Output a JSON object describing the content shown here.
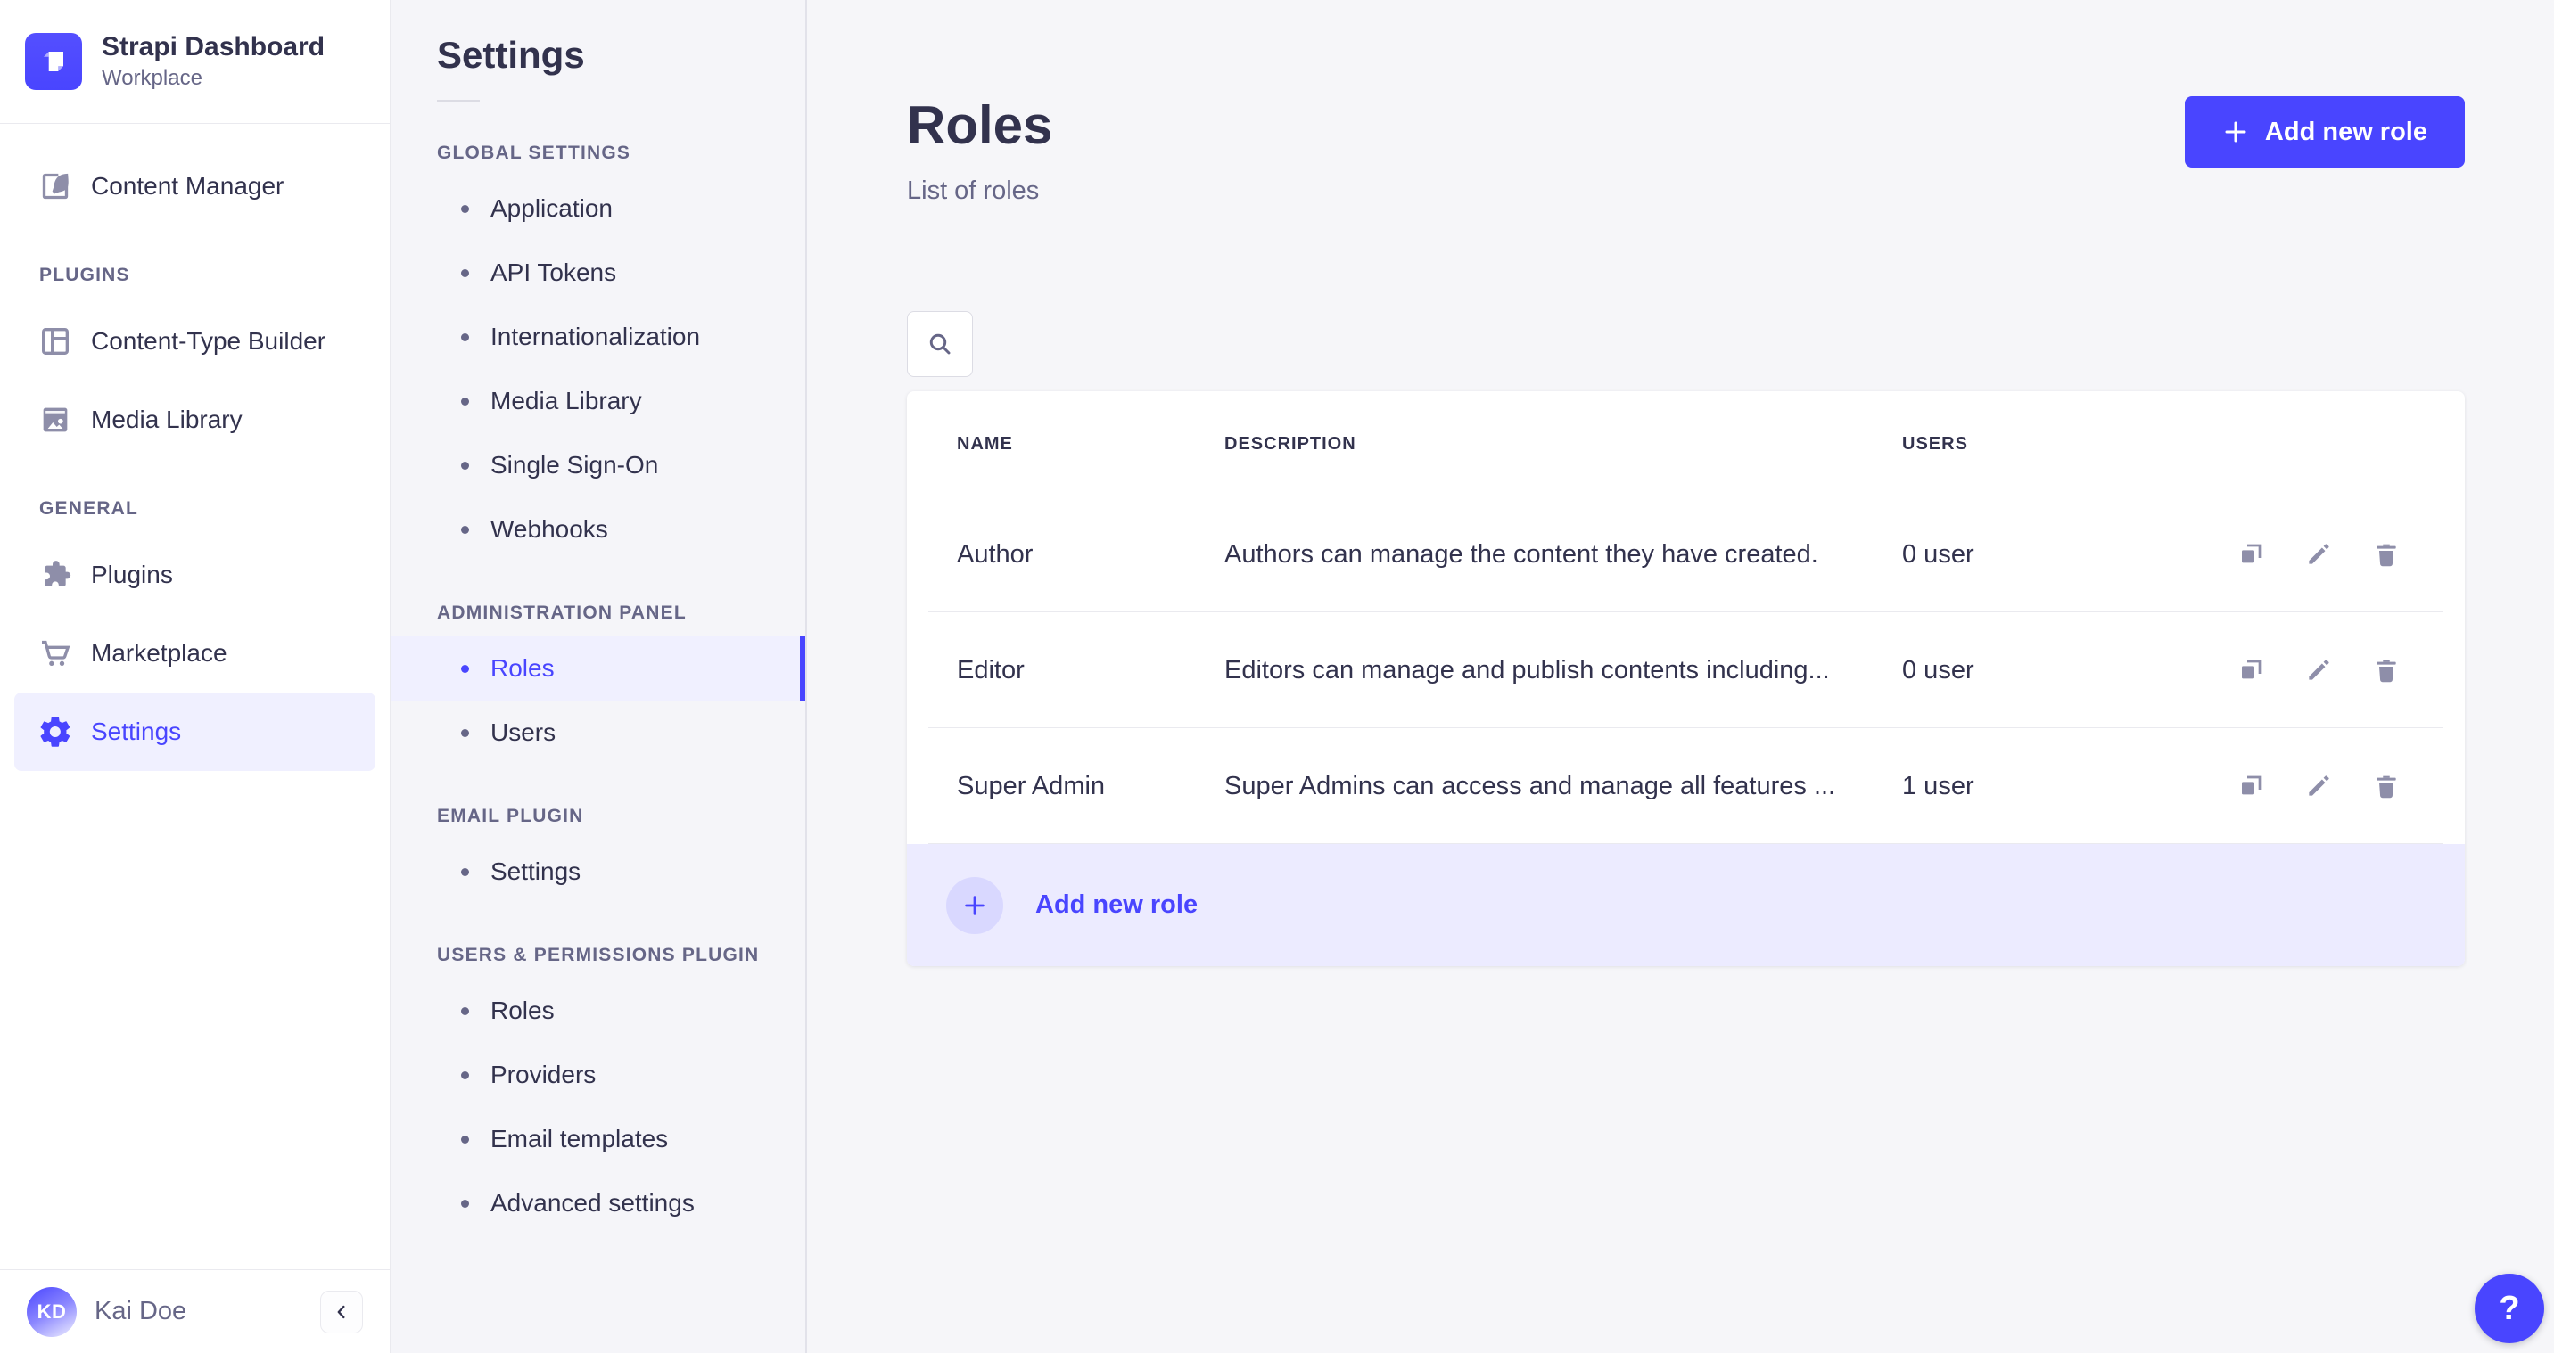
{
  "brand": {
    "name": "Strapi Dashboard",
    "workplace": "Workplace"
  },
  "sidebar": {
    "content_manager": "Content Manager",
    "plugins_section": {
      "label": "PLUGINS",
      "items": [
        {
          "label": "Content-Type Builder"
        },
        {
          "label": "Media Library"
        }
      ]
    },
    "general_section": {
      "label": "GENERAL",
      "items": [
        {
          "label": "Plugins"
        },
        {
          "label": "Marketplace"
        },
        {
          "label": "Settings"
        }
      ]
    },
    "user": {
      "initials": "KD",
      "name": "Kai Doe"
    }
  },
  "subnav": {
    "title": "Settings",
    "sections": [
      {
        "label": "GLOBAL SETTINGS",
        "items": [
          {
            "label": "Application"
          },
          {
            "label": "API Tokens"
          },
          {
            "label": "Internationalization"
          },
          {
            "label": "Media Library"
          },
          {
            "label": "Single Sign-On"
          },
          {
            "label": "Webhooks"
          }
        ]
      },
      {
        "label": "ADMINISTRATION PANEL",
        "items": [
          {
            "label": "Roles"
          },
          {
            "label": "Users"
          }
        ]
      },
      {
        "label": "EMAIL PLUGIN",
        "items": [
          {
            "label": "Settings"
          }
        ]
      },
      {
        "label": "USERS & PERMISSIONS PLUGIN",
        "items": [
          {
            "label": "Roles"
          },
          {
            "label": "Providers"
          },
          {
            "label": "Email templates"
          },
          {
            "label": "Advanced settings"
          }
        ]
      }
    ]
  },
  "page": {
    "title": "Roles",
    "subtitle": "List of roles",
    "add_button": "Add new role",
    "help": "?",
    "table": {
      "headers": {
        "name": "NAME",
        "description": "DESCRIPTION",
        "users": "USERS"
      },
      "rows": [
        {
          "name": "Author",
          "description": "Authors can manage the content they have created.",
          "users": "0 user"
        },
        {
          "name": "Editor",
          "description": "Editors can manage and publish contents including...",
          "users": "0 user"
        },
        {
          "name": "Super Admin",
          "description": "Super Admins can access and manage all features ...",
          "users": "1 user"
        }
      ],
      "footer_add": "Add new role"
    }
  },
  "icons": [
    "strapi-logo",
    "feather-icon",
    "layout-icon",
    "image-icon",
    "puzzle-icon",
    "cart-icon",
    "gear-icon",
    "search-icon",
    "plus-icon",
    "duplicate-icon",
    "pencil-icon",
    "trash-icon",
    "chevron-left-icon",
    "question-mark-icon"
  ],
  "colors": {
    "primary": "#4945ff",
    "primary_light": "#f0f0ff",
    "primary_circle": "#d9d8ff",
    "text": "#32324d",
    "text_muted": "#666687",
    "icon_gray": "#8e8ea9",
    "border": "#eaeaef",
    "background": "#f6f6f9",
    "surface": "#ffffff"
  }
}
